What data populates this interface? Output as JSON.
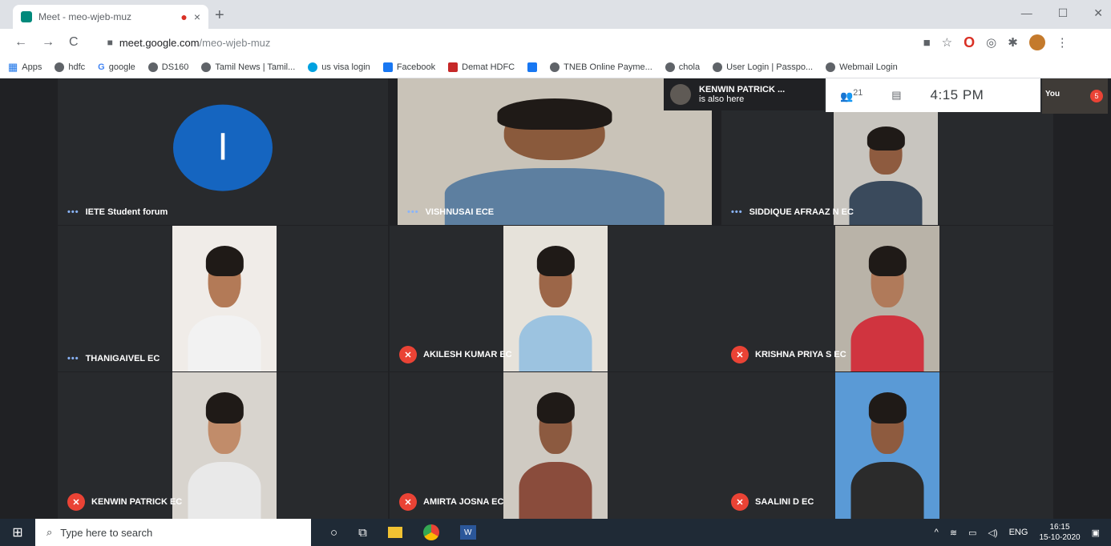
{
  "browser": {
    "tab_title": "Meet - meo-wjeb-muz",
    "tab_recording": "●",
    "tab_close": "×",
    "new_tab": "+",
    "win_min": "—",
    "win_max": "☐",
    "win_close": "✕",
    "nav_back": "←",
    "nav_forward": "→",
    "nav_reload": "C",
    "url_host": "meet.google.com",
    "url_path": "/meo-wjeb-muz",
    "bookmarks": [
      {
        "label": "Apps",
        "icon": "apps-grid-icon"
      },
      {
        "label": "hdfc",
        "icon": "globe-icon"
      },
      {
        "label": "google",
        "icon": "google-icon"
      },
      {
        "label": "DS160",
        "icon": "globe-icon"
      },
      {
        "label": "Tamil News | Tamil...",
        "icon": "news-icon"
      },
      {
        "label": "us visa login",
        "icon": "salesforce-icon"
      },
      {
        "label": "Facebook",
        "icon": "facebook-icon"
      },
      {
        "label": "Demat HDFC",
        "icon": "hdfc-icon"
      },
      {
        "label": "",
        "icon": "facebook-icon"
      },
      {
        "label": "TNEB Online Payme...",
        "icon": "globe-icon"
      },
      {
        "label": "chola",
        "icon": "globe-icon"
      },
      {
        "label": "User Login | Passpo...",
        "icon": "globe-icon"
      },
      {
        "label": "Webmail Login",
        "icon": "globe-icon"
      }
    ]
  },
  "meet": {
    "notification_name": "KENWIN PATRICK ...",
    "notification_text": "is also here",
    "people_count": "21",
    "time": "4:15 PM",
    "self_label": "You",
    "self_badge": "5",
    "presenter_initial": "I",
    "tiles": [
      {
        "name": "IETE Student forum",
        "status": "speaking"
      },
      {
        "name": "VISHNUSAI ECE",
        "status": "speaking"
      },
      {
        "name": "SIDDIQUE AFRAAZ N EC",
        "status": "speaking"
      },
      {
        "name": "THANIGAIVEL EC",
        "status": "speaking"
      },
      {
        "name": "AKILESH KUMAR EC",
        "status": "muted"
      },
      {
        "name": "KRISHNA PRIYA S EC",
        "status": "muted"
      },
      {
        "name": "KENWIN PATRICK EC",
        "status": "muted"
      },
      {
        "name": "AMIRTA JOSNA EC",
        "status": "muted"
      },
      {
        "name": "SAALINI D EC",
        "status": "muted"
      }
    ]
  },
  "taskbar": {
    "search_placeholder": "Type here to search",
    "lang": "ENG",
    "clock_time": "16:15",
    "clock_date": "15-10-2020"
  }
}
